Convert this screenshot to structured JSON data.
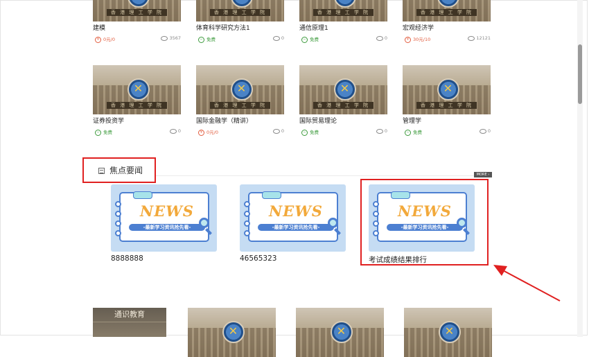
{
  "courses_top": [
    {
      "title": "建模",
      "price": "0元/0",
      "price_type": "paid",
      "views": "3567"
    },
    {
      "title": "体育科学研究方法1",
      "price": "免费",
      "price_type": "free",
      "views": "0"
    },
    {
      "title": "通信原理1",
      "price": "免费",
      "price_type": "free",
      "views": "0"
    },
    {
      "title": "宏观经济学",
      "price": "30元/10",
      "price_type": "paid",
      "views": "12121"
    }
  ],
  "courses_mid": [
    {
      "title": "证券投资学",
      "price": "免费",
      "price_type": "free",
      "views": "0"
    },
    {
      "title": "国际金融学（精讲）",
      "price": "0元/0",
      "price_type": "paid",
      "views": "0"
    },
    {
      "title": "国际贸易理论",
      "price": "免费",
      "price_type": "free",
      "views": "0"
    },
    {
      "title": "管理学",
      "price": "免费",
      "price_type": "free",
      "views": "0"
    }
  ],
  "thumbnail_sign": "香 港 理 工 学 院",
  "focus_section": {
    "title": "焦点要闻",
    "more_label": "MORE ›",
    "news": [
      {
        "title": "8888888",
        "banner_word": "NEWS",
        "banner_sub": "-最新学习资讯抢先看-"
      },
      {
        "title": "46565323",
        "banner_word": "NEWS",
        "banner_sub": "-最新学习资讯抢先看-"
      },
      {
        "title": "考试成绩结果排行",
        "banner_word": "NEWS",
        "banner_sub": "-最新学习资讯抢先看-"
      }
    ]
  },
  "bottom_category": "通识教育",
  "colors": {
    "highlight": "#e02020",
    "accent_blue": "#4c7fd1",
    "free": "#3b9a3b",
    "paid": "#e25c3e"
  }
}
